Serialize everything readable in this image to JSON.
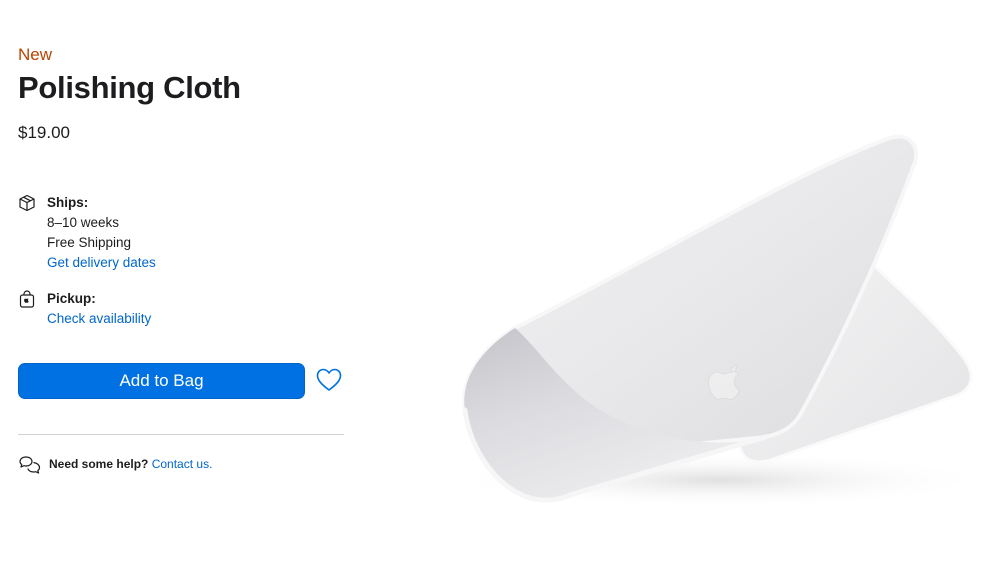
{
  "product": {
    "badge": "New",
    "title": "Polishing Cloth",
    "price": "$19.00"
  },
  "shipping": {
    "icon": "box-icon",
    "label": "Ships:",
    "timeframe": "8–10 weeks",
    "cost": "Free Shipping",
    "link": "Get delivery dates"
  },
  "pickup": {
    "icon": "store-bag-icon",
    "label": "Pickup:",
    "link": "Check availability"
  },
  "actions": {
    "add_to_bag": "Add to Bag",
    "favorite_icon": "heart-icon"
  },
  "help": {
    "icon": "chat-bubbles-icon",
    "prompt": "Need some help?",
    "link": "Contact us."
  },
  "colors": {
    "badge": "#b64400",
    "button": "#0071e3",
    "link": "#0066cc",
    "text": "#1d1d1f"
  }
}
